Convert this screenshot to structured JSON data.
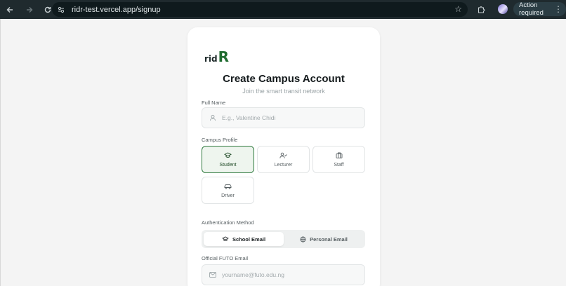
{
  "browser": {
    "url": "ridr-test.vercel.app/signup",
    "action_label": "Action required"
  },
  "brand": {
    "logo_a": "rid",
    "logo_b": "R"
  },
  "form": {
    "title": "Create Campus Account",
    "subtitle": "Join the smart transit network",
    "full_name": {
      "label": "Full Name",
      "placeholder": "E.g., Valentine Chidi"
    },
    "campus_profile": {
      "label": "Campus Profile",
      "options": [
        {
          "label": "Student",
          "icon": "graduation-cap-icon",
          "selected": true
        },
        {
          "label": "Lecturer",
          "icon": "user-check-icon",
          "selected": false
        },
        {
          "label": "Staff",
          "icon": "briefcase-icon",
          "selected": false
        },
        {
          "label": "Driver",
          "icon": "car-icon",
          "selected": false
        }
      ]
    },
    "auth_method": {
      "label": "Authentication Method",
      "options": [
        {
          "label": "School Email",
          "icon": "graduation-cap-icon",
          "selected": true
        },
        {
          "label": "Personal Email",
          "icon": "globe-icon",
          "selected": false
        }
      ]
    },
    "email": {
      "label": "Official FUTO Email",
      "placeholder": "yourname@futo.edu.ng"
    }
  },
  "colors": {
    "accent": "#1f6b2f",
    "chrome": "#1f2a2e"
  }
}
